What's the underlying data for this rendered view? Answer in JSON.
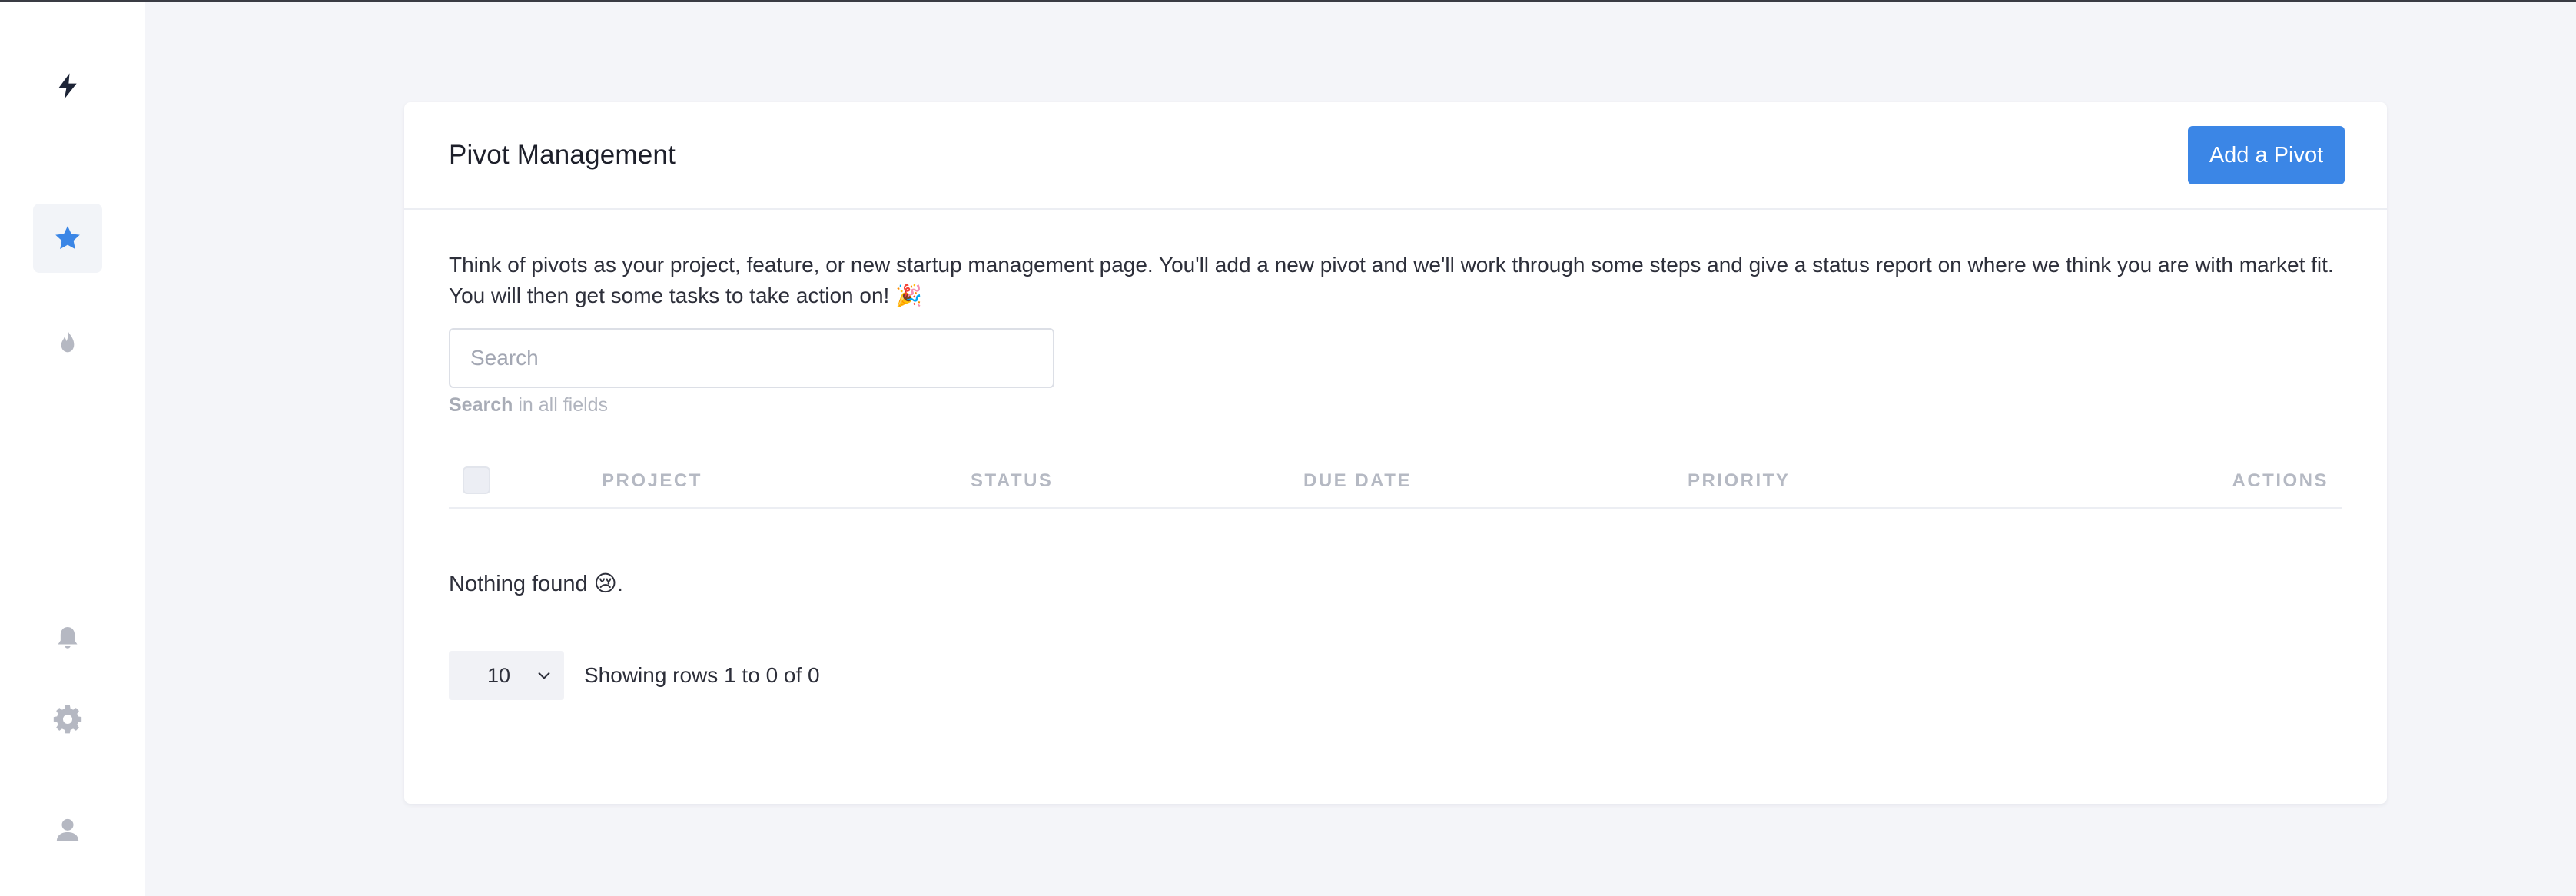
{
  "sidebar": {
    "icons": [
      "bolt-icon",
      "star-icon",
      "flame-icon",
      "bell-icon",
      "gear-icon",
      "user-icon"
    ],
    "accent": "#3b86e6",
    "muted": "#b5b8c2",
    "logo_color": "#1d2436"
  },
  "card": {
    "title": "Pivot Management",
    "add_button": "Add a Pivot",
    "intro": "Think of pivots as your project, feature, or new startup management page. You'll add a new pivot and we'll work through some steps and give a status report on where we think you are with market fit. You will then get some tasks to take action on! 🎉",
    "search": {
      "placeholder": "Search",
      "hint_bold": "Search",
      "hint_rest": " in all fields"
    },
    "table": {
      "columns": [
        "PROJECT",
        "STATUS",
        "DUE DATE",
        "PRIORITY",
        "ACTIONS"
      ],
      "rows": []
    },
    "empty_message": "Nothing found 😢.",
    "pagination": {
      "rows_per_page": "10",
      "showing": "Showing rows 1 to 0 of 0"
    }
  }
}
